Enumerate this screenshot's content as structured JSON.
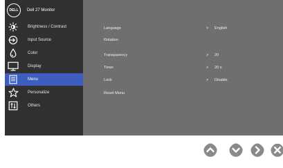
{
  "brand": {
    "logo_text": "DELL",
    "title": "Dell 27 Monitor"
  },
  "menu": [
    {
      "label": "Brightness / Contrast",
      "icon": "brightness-icon"
    },
    {
      "label": "Input Source",
      "icon": "input-source-icon"
    },
    {
      "label": "Color",
      "icon": "color-icon"
    },
    {
      "label": "Display",
      "icon": "display-icon"
    },
    {
      "label": "Menu",
      "icon": "menu-icon",
      "active": true
    },
    {
      "label": "Personalize",
      "icon": "star-icon"
    },
    {
      "label": "Others",
      "icon": "others-icon"
    }
  ],
  "settings": [
    {
      "name": "Language",
      "value": "English",
      "chevron": ">"
    },
    {
      "name": "Rotation",
      "value": "",
      "chevron": ""
    },
    {
      "name": "Transparency",
      "value": "20",
      "chevron": ">"
    },
    {
      "name": "Timer",
      "value": "20 s",
      "chevron": ">"
    },
    {
      "name": "Lock",
      "value": "Disable",
      "chevron": ">"
    },
    {
      "name": "Reset Menu",
      "value": "",
      "chevron": ""
    }
  ],
  "nav_buttons": [
    "up-icon",
    "down-icon",
    "right-icon",
    "close-icon"
  ],
  "colors": {
    "sidebar": "#303030",
    "panel": "#6f6f6f",
    "active": "#3d5dbf",
    "button": "#8a8a8a"
  }
}
